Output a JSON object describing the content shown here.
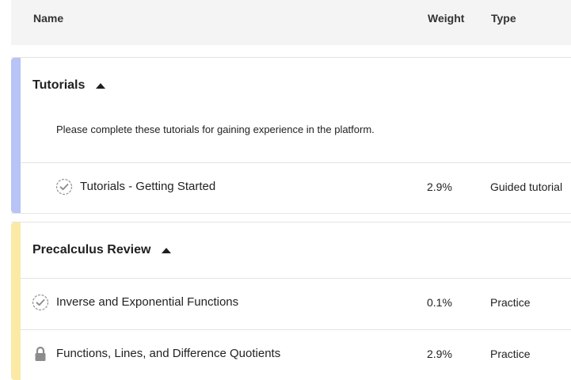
{
  "header": {
    "name_label": "Name",
    "weight_label": "Weight",
    "type_label": "Type"
  },
  "colors": {
    "tutorials_accent": "#b8c3f6",
    "precalc_accent": "#fbe9a6",
    "header_bg": "#f4f4f4"
  },
  "sections": [
    {
      "title": "Tutorials",
      "description": "Please complete these tutorials for gaining experience in the platform.",
      "items": [
        {
          "name": "Tutorials - Getting Started",
          "weight": "2.9%",
          "type": "Guided tutorial",
          "icon": "check-circle-icon"
        }
      ]
    },
    {
      "title": "Precalculus Review",
      "items": [
        {
          "name": "Inverse and Exponential Functions",
          "weight": "0.1%",
          "type": "Practice",
          "icon": "check-circle-icon"
        },
        {
          "name": "Functions, Lines, and Difference Quotients",
          "weight": "2.9%",
          "type": "Practice",
          "icon": "lock-icon"
        }
      ]
    }
  ]
}
